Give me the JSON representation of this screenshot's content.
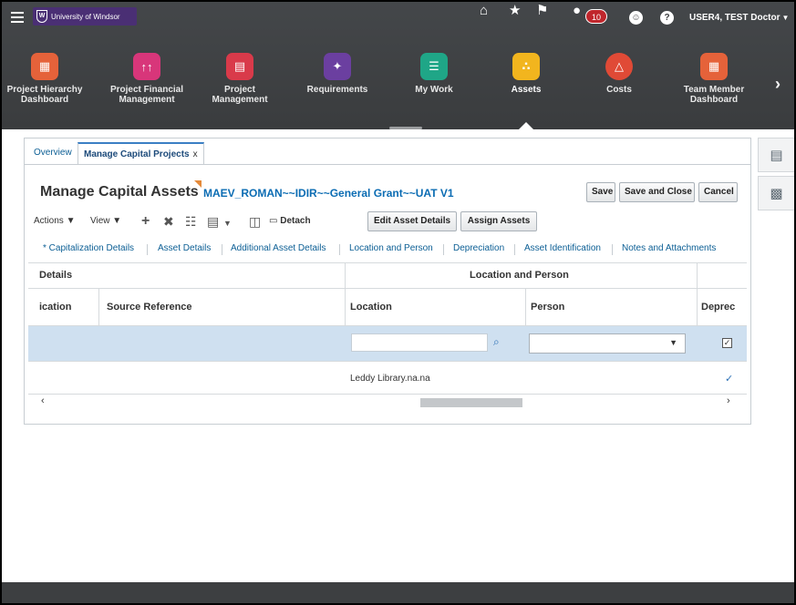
{
  "header": {
    "logo_text": "University of Windsor",
    "logo_mark": "W",
    "notification_count": "10",
    "user_name": "USER4, TEST Doctor",
    "icons": [
      "home-icon",
      "favorites-star-icon",
      "watchlist-flag-icon",
      "notifications-bell-icon",
      "accessibility-icon",
      "help-icon"
    ]
  },
  "springboard": {
    "items": [
      {
        "label": "Project Hierarchy Dashboard",
        "icon": "dashboard-icon",
        "color": "#e5623a"
      },
      {
        "label": "Project Financial Management",
        "icon": "financial-chart-icon",
        "color": "#d8367a"
      },
      {
        "label": "Project Management",
        "icon": "project-icon",
        "color": "#d93a4a"
      },
      {
        "label": "Requirements",
        "icon": "puzzle-icon",
        "color": "#6b3fa0"
      },
      {
        "label": "My Work",
        "icon": "checklist-icon",
        "color": "#1fa687"
      },
      {
        "label": "Assets",
        "icon": "assets-icon",
        "color": "#f2b51e"
      },
      {
        "label": "Costs",
        "icon": "costs-icon",
        "color": "#e04a36"
      },
      {
        "label": "Team Member Dashboard",
        "icon": "dashboard-icon",
        "color": "#e5623a"
      }
    ],
    "active": "Assets"
  },
  "tabs": [
    {
      "label": "Overview"
    },
    {
      "label": "Manage Capital Projects",
      "close": "x"
    }
  ],
  "page": {
    "title": "Manage Capital Assets",
    "subtitle": "MAEV_ROMAN~~IDIR~~General Grant~~UAT V1",
    "buttons": {
      "save": "Save",
      "save_close": "Save and Close",
      "cancel": "Cancel"
    }
  },
  "toolbar": {
    "actions": "Actions",
    "view": "View",
    "detach": "Detach",
    "edit_asset_details": "Edit Asset Details",
    "assign_assets": "Assign Assets"
  },
  "subnav": [
    "* Capitalization Details",
    "Asset Details",
    "Additional Asset Details",
    "Location and Person",
    "Depreciation",
    "Asset Identification",
    "Notes and Attachments"
  ],
  "table": {
    "group_headers": [
      "Details",
      "Location and Person"
    ],
    "columns": [
      "ication",
      "Source Reference",
      "Location",
      "Person",
      "Deprec"
    ],
    "rows": [
      {
        "location": "",
        "person": "",
        "depreciate": "checkbox"
      },
      {
        "location": "Leddy Library.na.na",
        "person": "",
        "depreciate": "✓"
      }
    ]
  }
}
